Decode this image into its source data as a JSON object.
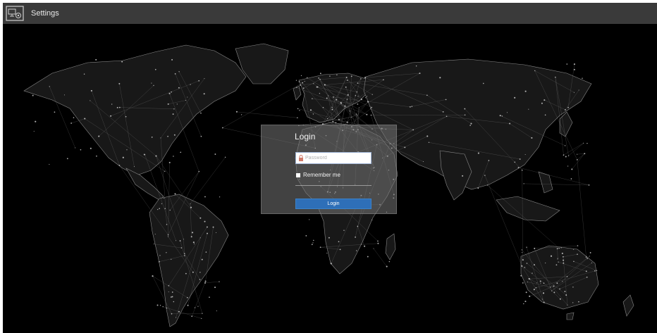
{
  "header": {
    "title": "Settings",
    "icon": "monitor-settings-icon"
  },
  "login": {
    "title": "Login",
    "password_placeholder": "Password",
    "password_value": "",
    "lock_icon": "lock-icon",
    "remember_label": "Remember me",
    "remember_checked": false,
    "button_label": "Login",
    "accent_color": "#2e6fb8"
  },
  "background": {
    "description_icon": "world-map-network-background"
  }
}
